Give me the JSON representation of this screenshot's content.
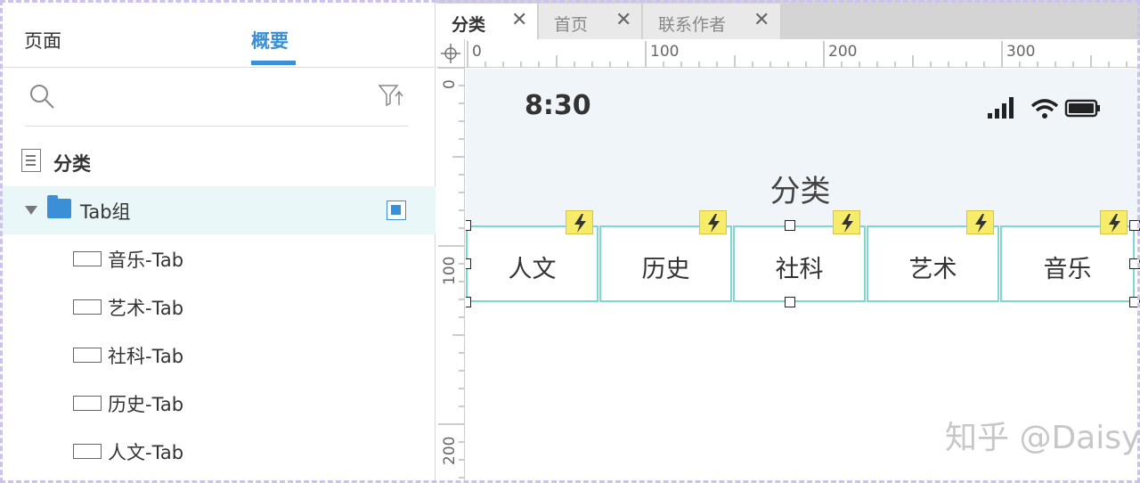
{
  "left_panel": {
    "tabs": [
      {
        "label": "页面",
        "active": false
      },
      {
        "label": "概要",
        "active": true
      }
    ],
    "search": {
      "icon": "search-icon",
      "filter_icon": "filter-icon"
    },
    "tree": [
      {
        "label": "分类",
        "type": "page",
        "icon": "page-icon"
      },
      {
        "label": "Tab组",
        "type": "group",
        "icon": "folder-icon",
        "selected": true,
        "expanded": true
      },
      {
        "label": "音乐-Tab",
        "type": "rectangle",
        "icon": "rectangle-icon"
      },
      {
        "label": "艺术-Tab",
        "type": "rectangle",
        "icon": "rectangle-icon"
      },
      {
        "label": "社科-Tab",
        "type": "rectangle",
        "icon": "rectangle-icon"
      },
      {
        "label": "历史-Tab",
        "type": "rectangle",
        "icon": "rectangle-icon"
      },
      {
        "label": "人文-Tab",
        "type": "rectangle",
        "icon": "rectangle-icon"
      }
    ]
  },
  "doc_tabs": [
    {
      "label": "分类",
      "active": true
    },
    {
      "label": "首页",
      "active": false
    },
    {
      "label": "联系作者",
      "active": false
    }
  ],
  "rulers": {
    "horizontal": [
      "0",
      "100",
      "200",
      "300"
    ],
    "vertical": [
      "0",
      "100",
      "200"
    ]
  },
  "canvas": {
    "status_bar": {
      "time": "8:30",
      "icons": [
        "signal-icon",
        "wifi-icon",
        "battery-icon"
      ]
    },
    "page_title": "分类",
    "tabs": [
      "人文",
      "历史",
      "社科",
      "艺术",
      "音乐"
    ],
    "interaction_icon": "lightning-icon"
  },
  "watermark": "知乎 @Daisy",
  "colors": {
    "accent": "#3a8fd6",
    "selection": "#7dd9d0",
    "selected_row": "#eaf7f8",
    "bolt": "#f6ec6a",
    "phone_header": "#f0f5fa",
    "frame_dash": "#cdc2ec"
  }
}
